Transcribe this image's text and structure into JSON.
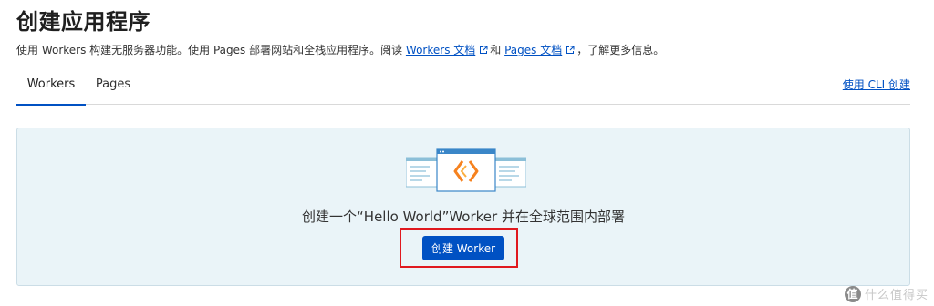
{
  "page": {
    "title": "创建应用程序"
  },
  "description": {
    "prefix": "使用 Workers 构建无服务器功能。使用 Pages 部署网站和全栈应用程序。阅读",
    "workers_docs_link": "Workers 文档",
    "between": "和",
    "pages_docs_link": "Pages 文档",
    "suffix": "，了解更多信息。"
  },
  "tabs": [
    {
      "label": "Workers",
      "active": true
    },
    {
      "label": "Pages",
      "active": false
    }
  ],
  "cli_link": "使用 CLI 创建",
  "panel": {
    "tagline": "创建一个“Hello World”Worker 并在全球范围内部署",
    "create_button": "创建 Worker"
  },
  "watermark": {
    "logo": "值",
    "text": "什么值得买"
  },
  "colors": {
    "accent": "#0051c3",
    "panel_bg": "#eaf4f8",
    "highlight_border": "#e0191f",
    "illustration_orange": "#f6821f"
  }
}
